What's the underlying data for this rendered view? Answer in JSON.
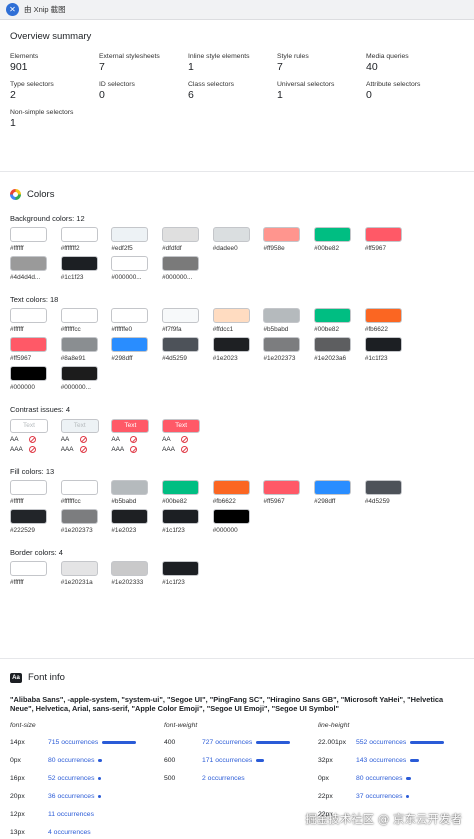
{
  "app": {
    "title": "由 Xnip 截图"
  },
  "overview": {
    "title": "Overview summary",
    "stats": [
      {
        "label": "Elements",
        "value": "901"
      },
      {
        "label": "External stylesheets",
        "value": "7"
      },
      {
        "label": "Inline style elements",
        "value": "1"
      },
      {
        "label": "Style rules",
        "value": "7"
      },
      {
        "label": "Media queries",
        "value": "40"
      },
      {
        "label": "Type selectors",
        "value": "2"
      },
      {
        "label": "ID selectors",
        "value": "0"
      },
      {
        "label": "Class selectors",
        "value": "6"
      },
      {
        "label": "Universal selectors",
        "value": "1"
      },
      {
        "label": "Attribute selectors",
        "value": "0"
      },
      {
        "label": "Non-simple selectors",
        "value": "1"
      }
    ]
  },
  "colors": {
    "title": "Colors",
    "background": {
      "title": "Background colors: 12",
      "items": [
        {
          "hex": "#ffffff",
          "color": "#ffffff"
        },
        {
          "hex": "#fffffff2",
          "color": "#fffffff2"
        },
        {
          "hex": "#edf2f5",
          "color": "#edf2f5"
        },
        {
          "hex": "#dfdfdf",
          "color": "#dfdfdf"
        },
        {
          "hex": "#dadee0",
          "color": "#dadee0"
        },
        {
          "hex": "#ff958e",
          "color": "#ff958e"
        },
        {
          "hex": "#00be82",
          "color": "#00be82"
        },
        {
          "hex": "#ff5967",
          "color": "#ff5967"
        },
        {
          "hex": "#4d4d4d...",
          "color": "#9a9a9a"
        },
        {
          "hex": "#1c1f23",
          "color": "#1c1f23"
        },
        {
          "hex": "#000000...",
          "color": "#ffffff"
        },
        {
          "hex": "#000000...",
          "color": "#7a7a7a"
        }
      ]
    },
    "text": {
      "title": "Text colors: 18",
      "items": [
        {
          "hex": "#ffffff",
          "color": "#ffffff"
        },
        {
          "hex": "#ffffffcc",
          "color": "#ffffffcc"
        },
        {
          "hex": "#ffffffe0",
          "color": "#ffffffe0"
        },
        {
          "hex": "#f7f9fa",
          "color": "#f7f9fa"
        },
        {
          "hex": "#ffdcc1",
          "color": "#ffdcc1"
        },
        {
          "hex": "#b5babd",
          "color": "#b5babd"
        },
        {
          "hex": "#00be82",
          "color": "#00be82"
        },
        {
          "hex": "#fb6622",
          "color": "#fb6622"
        },
        {
          "hex": "#ff5967",
          "color": "#ff5967"
        },
        {
          "hex": "#8a8e91",
          "color": "#8a8e91"
        },
        {
          "hex": "#298dff",
          "color": "#298dff"
        },
        {
          "hex": "#4d5259",
          "color": "#4d5259"
        },
        {
          "hex": "#1e2023",
          "color": "#1e2023"
        },
        {
          "hex": "#1e202373",
          "color": "#7c7d7f"
        },
        {
          "hex": "#1e2023a6",
          "color": "#5d5e60"
        },
        {
          "hex": "#1c1f23",
          "color": "#1c1f23"
        },
        {
          "hex": "#000000",
          "color": "#000000"
        },
        {
          "hex": "#000000...",
          "color": "#1c1c1c"
        }
      ]
    },
    "contrast": {
      "title": "Contrast issues: 4",
      "items": [
        {
          "label": "Text",
          "bg": "#ffffff",
          "fg": "#b5babd",
          "aa": "AA",
          "aaa": "AAA"
        },
        {
          "label": "Text",
          "bg": "#edf2f5",
          "fg": "#b5babd",
          "aa": "AA",
          "aaa": "AAA"
        },
        {
          "label": "Text",
          "bg": "#ff5967",
          "fg": "#ffffff",
          "aa": "AA",
          "aaa": "AAA"
        },
        {
          "label": "Text",
          "bg": "#ff5967",
          "fg": "#ffffff",
          "aa": "AA",
          "aaa": "AAA"
        }
      ]
    },
    "fill": {
      "title": "Fill colors: 13",
      "items": [
        {
          "hex": "#ffffff",
          "color": "#ffffff"
        },
        {
          "hex": "#ffffffcc",
          "color": "#ffffffcc"
        },
        {
          "hex": "#b5babd",
          "color": "#b5babd"
        },
        {
          "hex": "#00be82",
          "color": "#00be82"
        },
        {
          "hex": "#fb6622",
          "color": "#fb6622"
        },
        {
          "hex": "#ff5967",
          "color": "#ff5967"
        },
        {
          "hex": "#298dff",
          "color": "#298dff"
        },
        {
          "hex": "#4d5259",
          "color": "#4d5259"
        },
        {
          "hex": "#222529",
          "color": "#222529"
        },
        {
          "hex": "#1e202373",
          "color": "#7c7d7f"
        },
        {
          "hex": "#1e2023",
          "color": "#1e2023"
        },
        {
          "hex": "#1c1f23",
          "color": "#1c1f23"
        },
        {
          "hex": "#000000",
          "color": "#000000"
        }
      ]
    },
    "border": {
      "title": "Border colors: 4",
      "items": [
        {
          "hex": "#ffffff",
          "color": "#ffffff"
        },
        {
          "hex": "#1e20231a",
          "color": "#e4e4e5"
        },
        {
          "hex": "#1e202333",
          "color": "#c9c9ca"
        },
        {
          "hex": "#1c1f23",
          "color": "#1c1f23"
        }
      ]
    }
  },
  "font": {
    "title": "Font info",
    "icon_text": "Aa",
    "family": "\"Alibaba Sans\", -apple-system, \"system-ui\", \"Segoe UI\", \"PingFang SC\", \"Hiragino Sans GB\", \"Microsoft YaHei\", \"Helvetica Neue\", Helvetica, Arial, sans-serif, \"Apple Color Emoji\", \"Segoe UI Emoji\", \"Segoe UI Symbol\"",
    "columns": [
      {
        "header": "font-size",
        "rows": [
          {
            "value": "14px",
            "occ": "715 occurrences",
            "share": 1.0
          },
          {
            "value": "0px",
            "occ": "80 occurrences",
            "share": 0.11
          },
          {
            "value": "16px",
            "occ": "52 occurrences",
            "share": 0.07
          },
          {
            "value": "20px",
            "occ": "36 occurrences",
            "share": 0.05
          },
          {
            "value": "12px",
            "occ": "11 occurrences",
            "share": 0.0
          },
          {
            "value": "13px",
            "occ": "4 occurrences",
            "share": 0.0
          }
        ]
      },
      {
        "header": "font-weight",
        "rows": [
          {
            "value": "400",
            "occ": "727 occurrences",
            "share": 1.0
          },
          {
            "value": "600",
            "occ": "171 occurrences",
            "share": 0.24
          },
          {
            "value": "500",
            "occ": "2 occurrences",
            "share": 0.0
          }
        ]
      },
      {
        "header": "line-height",
        "rows": [
          {
            "value": "22.001px",
            "occ": "552 occurrences",
            "share": 1.0
          },
          {
            "value": "32px",
            "occ": "143 occurrences",
            "share": 0.26
          },
          {
            "value": "0px",
            "occ": "80 occurrences",
            "share": 0.14
          },
          {
            "value": "22px",
            "occ": "37 occurrences",
            "share": 0.07
          },
          {
            "value": "22px",
            "occ": "",
            "share": 0.0
          }
        ]
      }
    ]
  },
  "watermark": "掘金技术社区 @ 京东云开发者"
}
